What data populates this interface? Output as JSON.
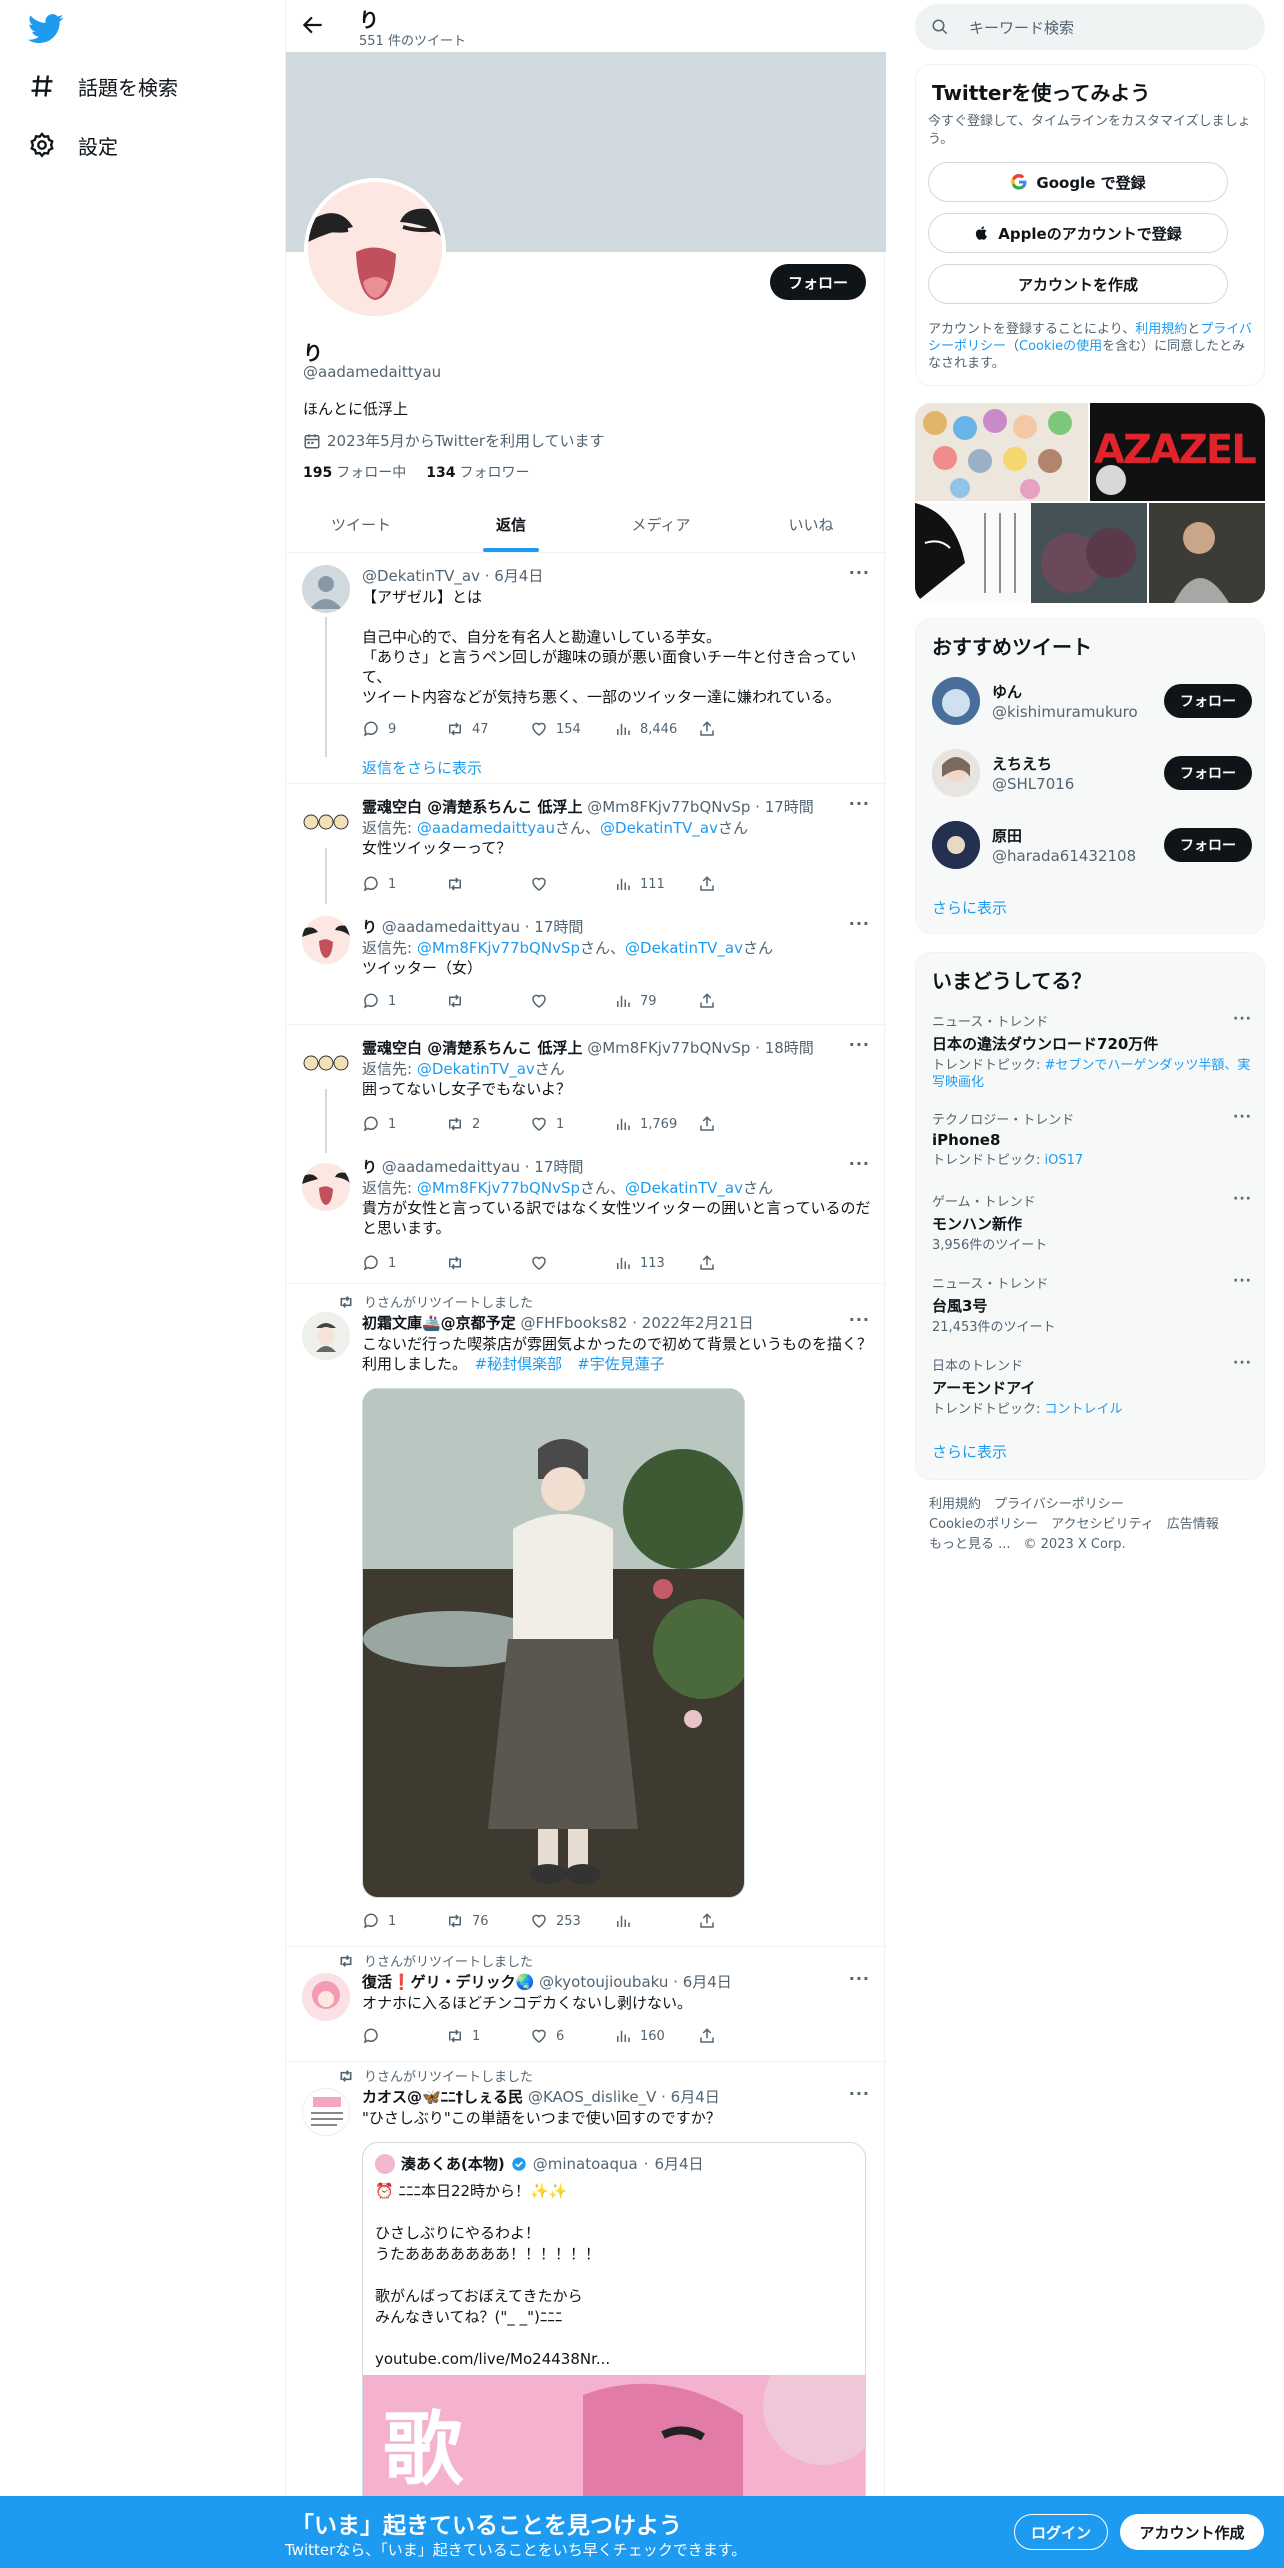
{
  "nav": {
    "explore": "話題を検索",
    "settings": "設定"
  },
  "profile": {
    "header_name": "り",
    "tweet_count": "551 件のツイート",
    "name": "り",
    "handle": "@aadamedaittyau",
    "bio": "ほんとに低浮上",
    "joined": "2023年5月からTwitterを利用しています",
    "following_count": "195",
    "following_label": "フォロー中",
    "followers_count": "134",
    "followers_label": "フォロワー",
    "follow_button": "フォロー"
  },
  "tabs": [
    "ツイート",
    "返信",
    "メディア",
    "いいね"
  ],
  "tweets": [
    {
      "name": "",
      "handle": "@DekatinTV_av",
      "date": "6月4日",
      "text": "【アザゼル】とは\n\n自己中心的で、自分を有名人と勘違いしている芋女。\n「ありさ」と言うペン回しが趣味の頭が悪い面食いチー牛と付き合っていて、\nツイート内容などが気持ち悪く、一部のツイッター達に嫌われている。",
      "replies": "9",
      "retweets": "47",
      "likes": "154",
      "views": "8,446"
    },
    {
      "name": "霊魂空白 @清楚系ちんこ 低浮上",
      "handle": "@Mm8FKjv77bQNvSp",
      "date": "17時間",
      "reply_prefix": "返信先: ",
      "reply_to_1": "@aadamedaittyau",
      "reply_mid": "さん、",
      "reply_to_2": "@DekatinTV_av",
      "reply_suffix": "さん",
      "text": "女性ツイッターって？",
      "replies": "1",
      "retweets": "",
      "likes": "",
      "views": "111"
    },
    {
      "name": "り",
      "handle": "@aadamedaittyau",
      "date": "17時間",
      "reply_prefix": "返信先: ",
      "reply_to_1": "@Mm8FKjv77bQNvSp",
      "reply_mid": "さん、",
      "reply_to_2": "@DekatinTV_av",
      "reply_suffix": "さん",
      "text": "ツイッター（女）",
      "replies": "1",
      "retweets": "",
      "likes": "",
      "views": "79"
    },
    {
      "name": "霊魂空白 @清楚系ちんこ 低浮上",
      "handle": "@Mm8FKjv77bQNvSp",
      "date": "18時間",
      "reply_prefix": "返信先: ",
      "reply_to_1": "@DekatinTV_av",
      "reply_suffix": "さん",
      "text": "囲ってないし女子でもないよ？",
      "replies": "1",
      "retweets": "2",
      "likes": "1",
      "views": "1,769"
    },
    {
      "name": "り",
      "handle": "@aadamedaittyau",
      "date": "17時間",
      "reply_prefix": "返信先: ",
      "reply_to_1": "@Mm8FKjv77bQNvSp",
      "reply_mid": "さん、",
      "reply_to_2": "@DekatinTV_av",
      "reply_suffix": "さん",
      "text": "貴方が女性と言っている訳ではなく女性ツイッターの囲いと言っているのだと思います。",
      "replies": "1",
      "retweets": "",
      "likes": "",
      "views": "113"
    },
    {
      "retweeted_by": "りさんがリツイートしました",
      "name": "初霜文庫🚢@京都予定",
      "handle": "@FHFbooks82",
      "date": "2022年2月21日",
      "text": "こないだ行った喫茶店が雰囲気よかったので初めて背景というものを描く？利用しました。",
      "hashtag_1": "#秘封倶楽部",
      "hashtag_2": "#宇佐見蓮子",
      "replies": "1",
      "retweets": "76",
      "likes": "253",
      "views": ""
    },
    {
      "retweeted_by": "りさんがリツイートしました",
      "name": "復活❗️ゲリ・デリック🌏",
      "handle": "@kyotoujioubaku",
      "date": "6月4日",
      "text": "オナホに入るほどチンコデカくないし剥けない。",
      "replies": "",
      "retweets": "1",
      "likes": "6",
      "views": "160"
    },
    {
      "retweeted_by": "りさんがリツイートしました",
      "name": "カオス@🦋ﾆﾆ†しぇる民",
      "handle": "@KAOS_dislike_V",
      "date": "6月4日",
      "text": "\"ひさしぶり\"この単語をいつまで使い回すのですか？",
      "quote": {
        "name": "湊あくあ(本物)",
        "handle": "@minatoaqua",
        "date": "6月4日",
        "text": "⏰ ﾆﾆﾆ本日22時から！✨✨\n\nひさしぶりにやるわよ！\nうたあああああああ！！！！！！\n\n歌がんばっておぼえてきたから\nみんなきいてね？(\"_ _\")ﾆﾆﾆ\n\nyoutube.com/live/Mo24438Nr...",
        "image_text": "歌"
      }
    }
  ],
  "show_more_replies": "返信をさらに表示",
  "right": {
    "search_placeholder": "キーワード検索",
    "signup": {
      "title": "Twitterを使ってみよう",
      "subtitle": "今すぐ登録して、タイムラインをカスタマイズしましょう。",
      "google": "Google で登録",
      "apple": "Appleのアカウントで登録",
      "create": "アカウントを作成",
      "terms_1": "アカウントを登録することにより、",
      "terms_link_1": "利用規約",
      "terms_2": "と",
      "terms_link_2": "プライバシーポリシー",
      "terms_3": "（",
      "terms_link_3": "Cookieの使用",
      "terms_4": "を含む）に同意したとみなされます。"
    },
    "media_text": "AZAZEL",
    "recommended": {
      "title": "おすすめツイート",
      "users": [
        {
          "name": "ゆん",
          "handle": "@kishimuramukuro",
          "button": "フォロー"
        },
        {
          "name": "えちえち",
          "handle": "@SHL7016",
          "button": "フォロー"
        },
        {
          "name": "原田",
          "handle": "@harada61432108",
          "button": "フォロー"
        }
      ],
      "more": "さらに表示"
    },
    "trends": {
      "title": "いまどうしてる？",
      "items": [
        {
          "category": "ニュース・トレンド",
          "title": "日本の違法ダウンロード720万件",
          "sub_prefix": "トレンドトピック: ",
          "sub_link": "#セブンでハーゲンダッツ半額、実写映画化"
        },
        {
          "category": "テクノロジー・トレンド",
          "title": "iPhone8",
          "sub_prefix": "トレンドトピック: ",
          "sub_link": "iOS17"
        },
        {
          "category": "ゲーム・トレンド",
          "title": "モンハン新作",
          "sub_prefix": "3,956件のツイート",
          "sub_link": ""
        },
        {
          "category": "ニュース・トレンド",
          "title": "台風3号",
          "sub_prefix": "21,453件のツイート",
          "sub_link": ""
        },
        {
          "category": "日本のトレンド",
          "title": "アーモンドアイ",
          "sub_prefix": "トレンドトピック: ",
          "sub_link": "コントレイル"
        }
      ],
      "more": "さらに表示"
    },
    "footer": {
      "line1": "利用規約　プライバシーポリシー",
      "line2": "Cookieのポリシー　アクセシビリティ　広告情報",
      "line3": "もっと見る ...　© 2023 X Corp."
    }
  },
  "bottom_bar": {
    "title": "「いま」起きていることを見つけよう",
    "subtitle": "Twitterなら、「いま」起きていることをいち早くチェックできます。",
    "login": "ログイン",
    "signup": "アカウント作成"
  },
  "colors": {
    "accent": "#1d9bf0",
    "text": "#0f1419",
    "secondary": "#536471",
    "banner": "#cfd9de"
  }
}
